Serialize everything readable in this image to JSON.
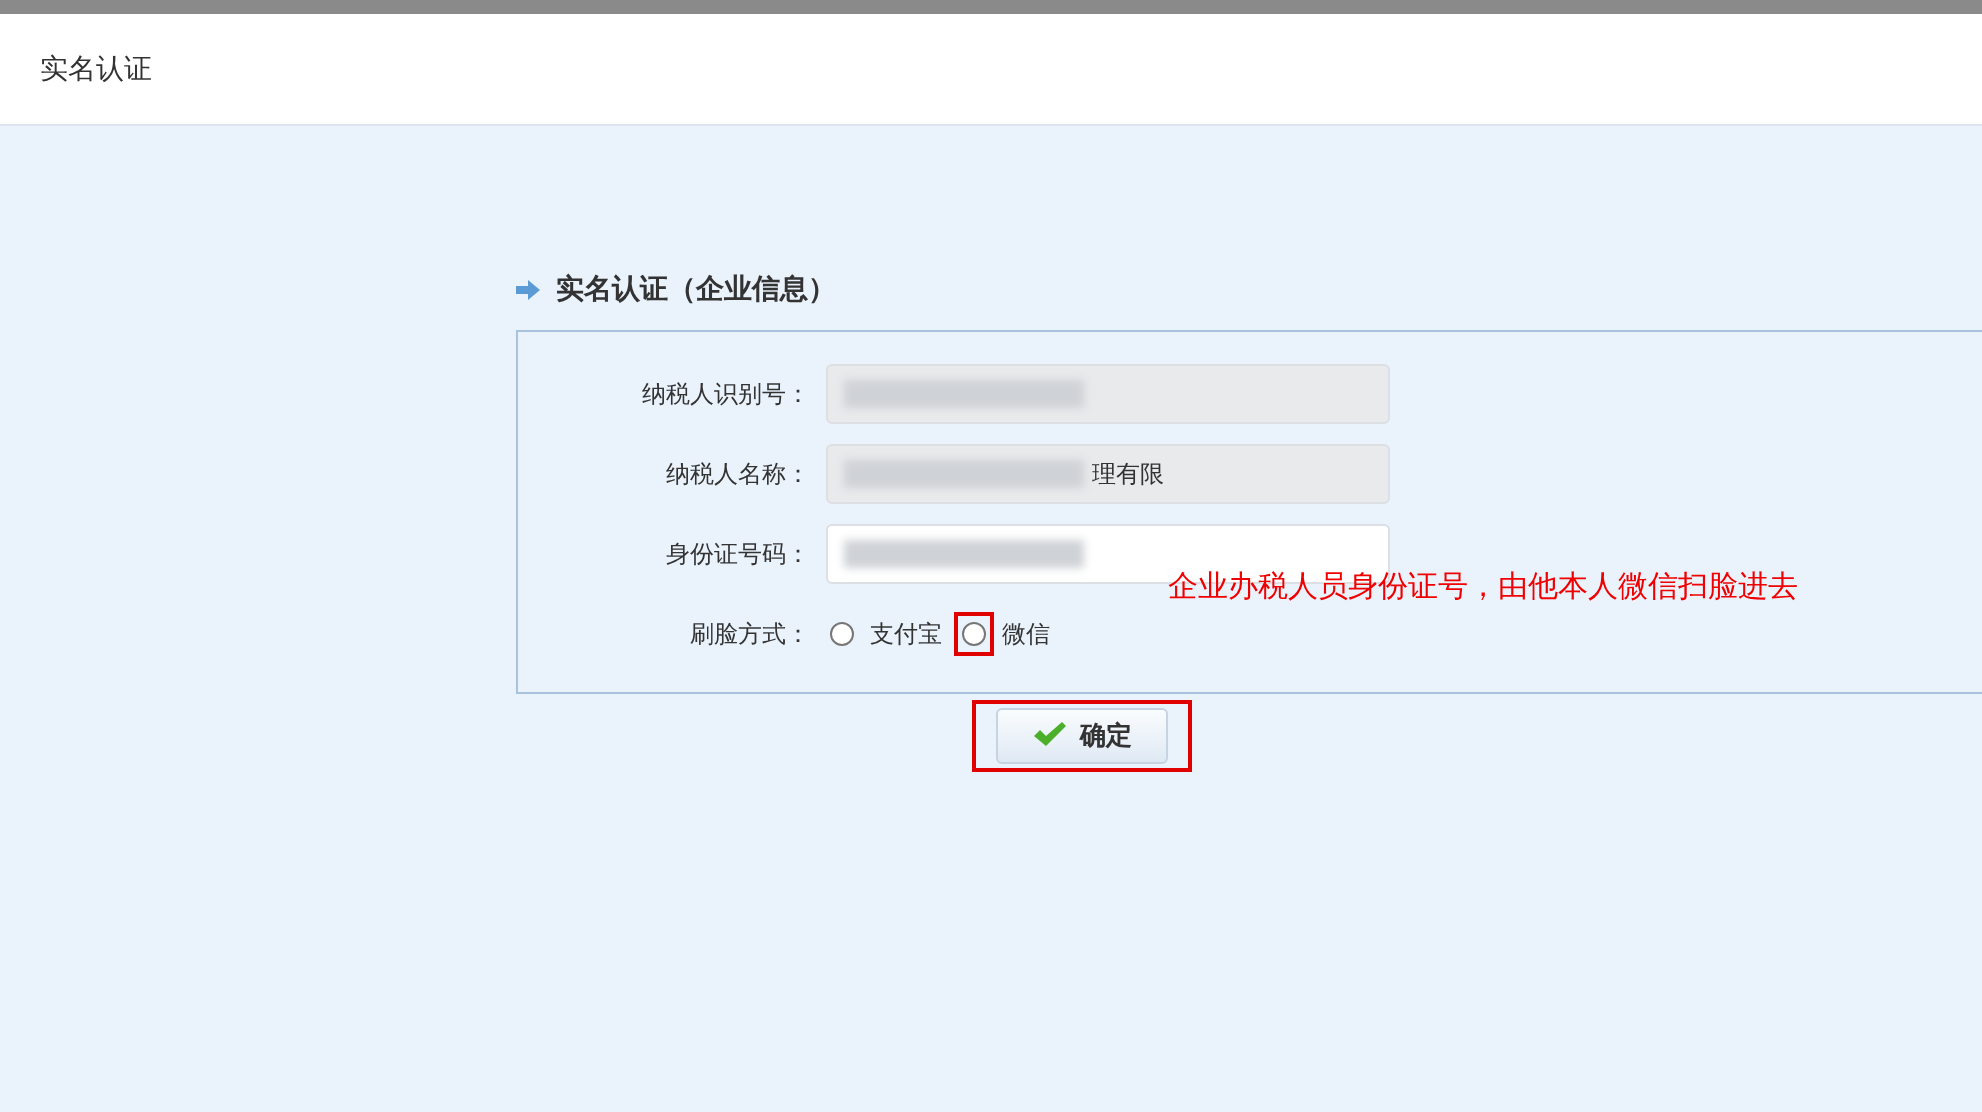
{
  "header": {
    "title": "实名认证"
  },
  "section": {
    "title": "实名认证（企业信息）"
  },
  "fields": [
    {
      "label": "纳税人识别号：",
      "readonly": true
    },
    {
      "label": "纳税人名称：",
      "value": "理有限",
      "readonly": true
    },
    {
      "label": "身份证号码：",
      "readonly": false
    }
  ],
  "face_method": {
    "label": "刷脸方式：",
    "options": [
      {
        "label": "支付宝",
        "selected": false,
        "highlighted": false
      },
      {
        "label": "微信",
        "selected": false,
        "highlighted": true
      }
    ]
  },
  "annotation": "企业办税人员身份证号，由他本人微信扫脸进去",
  "confirm": {
    "label": "确定",
    "highlighted": true
  }
}
